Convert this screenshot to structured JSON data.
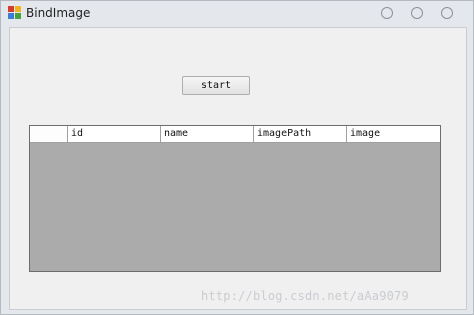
{
  "window": {
    "title": "BindImage"
  },
  "toolbar": {
    "start_label": "start"
  },
  "grid": {
    "columns": [
      "id",
      "name",
      "imagePath",
      "image"
    ],
    "rows": []
  },
  "watermark": {
    "text": "http://blog.csdn.net/aAa9079"
  },
  "icons": {
    "app": "app-icon",
    "minimize": "circle-icon",
    "maximize": "circle-icon",
    "close": "circle-icon"
  },
  "colors": {
    "grid_background": "#ababab",
    "window_background": "#f0f0f0"
  }
}
